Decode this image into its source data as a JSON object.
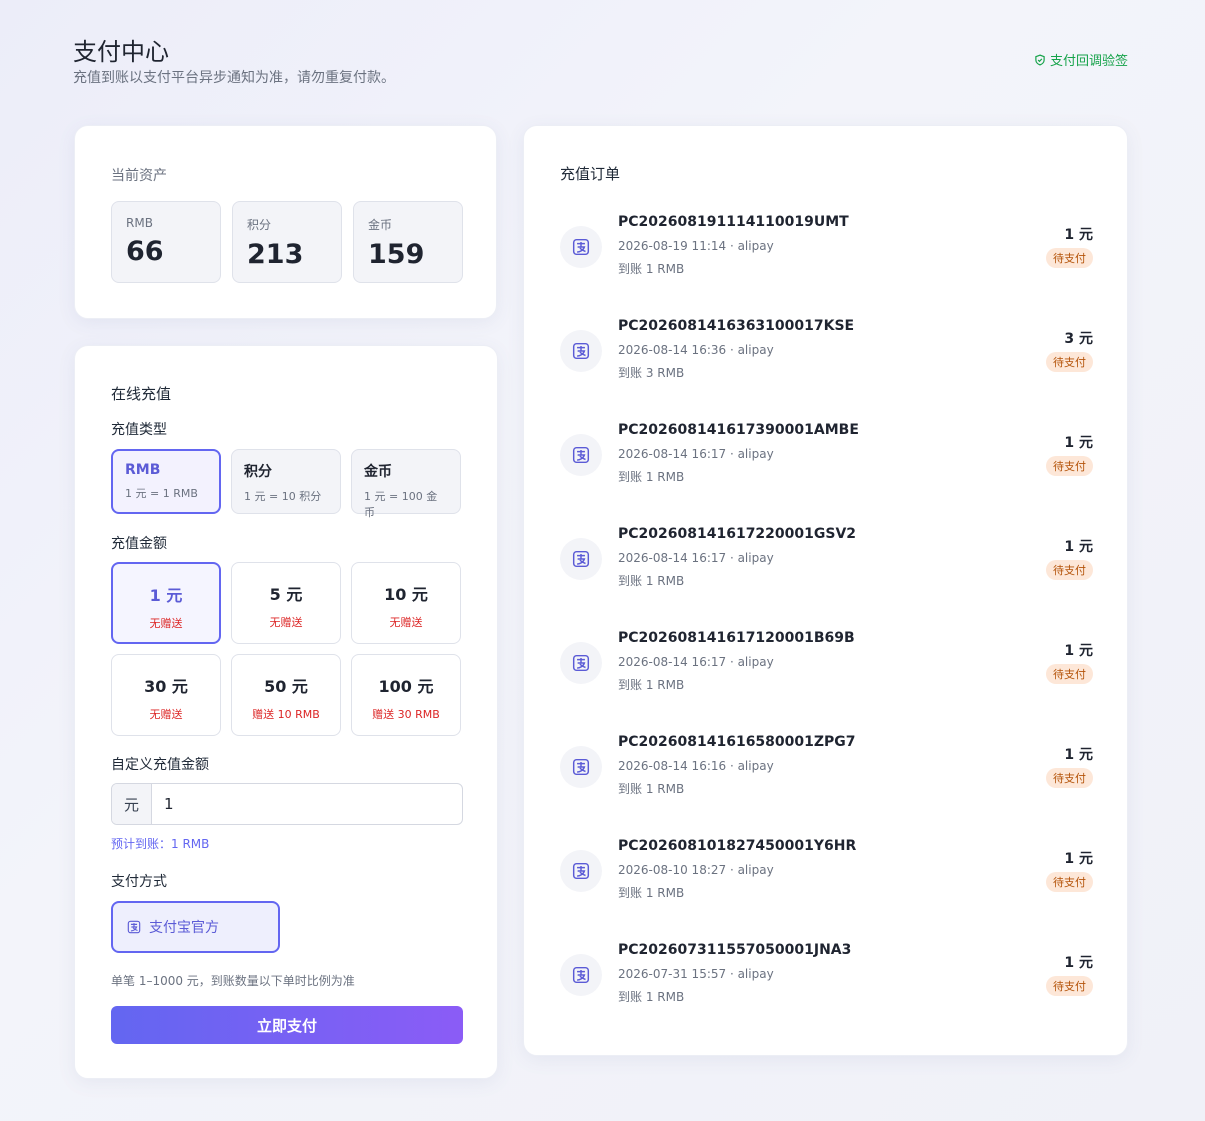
{
  "header": {
    "title": "支付中心",
    "subtitle": "充值到账以支付平台异步通知为准，请勿重复付款。",
    "verify_link": "支付回调验签",
    "verify_icon": "shield-check-icon"
  },
  "assets": {
    "title": "当前资产",
    "items": [
      {
        "label": "RMB",
        "value": "66"
      },
      {
        "label": "积分",
        "value": "213"
      },
      {
        "label": "金币",
        "value": "159"
      }
    ]
  },
  "recharge": {
    "title": "在线充值",
    "type_label": "充值类型",
    "types": [
      {
        "name": "RMB",
        "rate": "1 元 = 1 RMB",
        "selected": true
      },
      {
        "name": "积分",
        "rate": "1 元 = 10 积分",
        "selected": false
      },
      {
        "name": "金币",
        "rate": "1 元 = 100 金币",
        "selected": false
      }
    ],
    "amount_label": "充值金额",
    "amounts": [
      {
        "amount": "1 元",
        "bonus": "无赠送",
        "selected": true
      },
      {
        "amount": "5 元",
        "bonus": "无赠送",
        "selected": false
      },
      {
        "amount": "10 元",
        "bonus": "无赠送",
        "selected": false
      },
      {
        "amount": "30 元",
        "bonus": "无赠送",
        "selected": false
      },
      {
        "amount": "50 元",
        "bonus": "赠送 10 RMB",
        "selected": false
      },
      {
        "amount": "100 元",
        "bonus": "赠送 30 RMB",
        "selected": false
      }
    ],
    "custom_label": "自定义充值金额",
    "custom_prefix": "元",
    "custom_value": "1",
    "estimate": "预计到账：1 RMB",
    "method_label": "支付方式",
    "method": "支付宝官方",
    "method_icon": "alipay-icon",
    "note": "单笔 1–1000 元，到账数量以下单时比例为准",
    "pay_button": "立即支付"
  },
  "orders": {
    "title": "充值订单",
    "items": [
      {
        "id": "PC202608191114110019UMT",
        "meta": "2026-08-19 11:14 · alipay",
        "arrive": "到账 1 RMB",
        "price": "1 元",
        "status": "待支付"
      },
      {
        "id": "PC2026081416363100017KSE",
        "meta": "2026-08-14 16:36 · alipay",
        "arrive": "到账 3 RMB",
        "price": "3 元",
        "status": "待支付"
      },
      {
        "id": "PC202608141617390001AMBE",
        "meta": "2026-08-14 16:17 · alipay",
        "arrive": "到账 1 RMB",
        "price": "1 元",
        "status": "待支付"
      },
      {
        "id": "PC202608141617220001GSV2",
        "meta": "2026-08-14 16:17 · alipay",
        "arrive": "到账 1 RMB",
        "price": "1 元",
        "status": "待支付"
      },
      {
        "id": "PC202608141617120001B69B",
        "meta": "2026-08-14 16:17 · alipay",
        "arrive": "到账 1 RMB",
        "price": "1 元",
        "status": "待支付"
      },
      {
        "id": "PC202608141616580001ZPG7",
        "meta": "2026-08-14 16:16 · alipay",
        "arrive": "到账 1 RMB",
        "price": "1 元",
        "status": "待支付"
      },
      {
        "id": "PC202608101827450001Y6HR",
        "meta": "2026-08-10 18:27 · alipay",
        "arrive": "到账 1 RMB",
        "price": "1 元",
        "status": "待支付"
      },
      {
        "id": "PC202607311557050001JNA3",
        "meta": "2026-07-31 15:57 · alipay",
        "arrive": "到账 1 RMB",
        "price": "1 元",
        "status": "待支付"
      }
    ]
  },
  "colors": {
    "accent": "#6366f1",
    "accent_end": "#8b5cf6",
    "verify": "#16a34a",
    "bonus": "#dc2626",
    "status_bg": "#fde7d8",
    "status_text": "#b45309"
  }
}
